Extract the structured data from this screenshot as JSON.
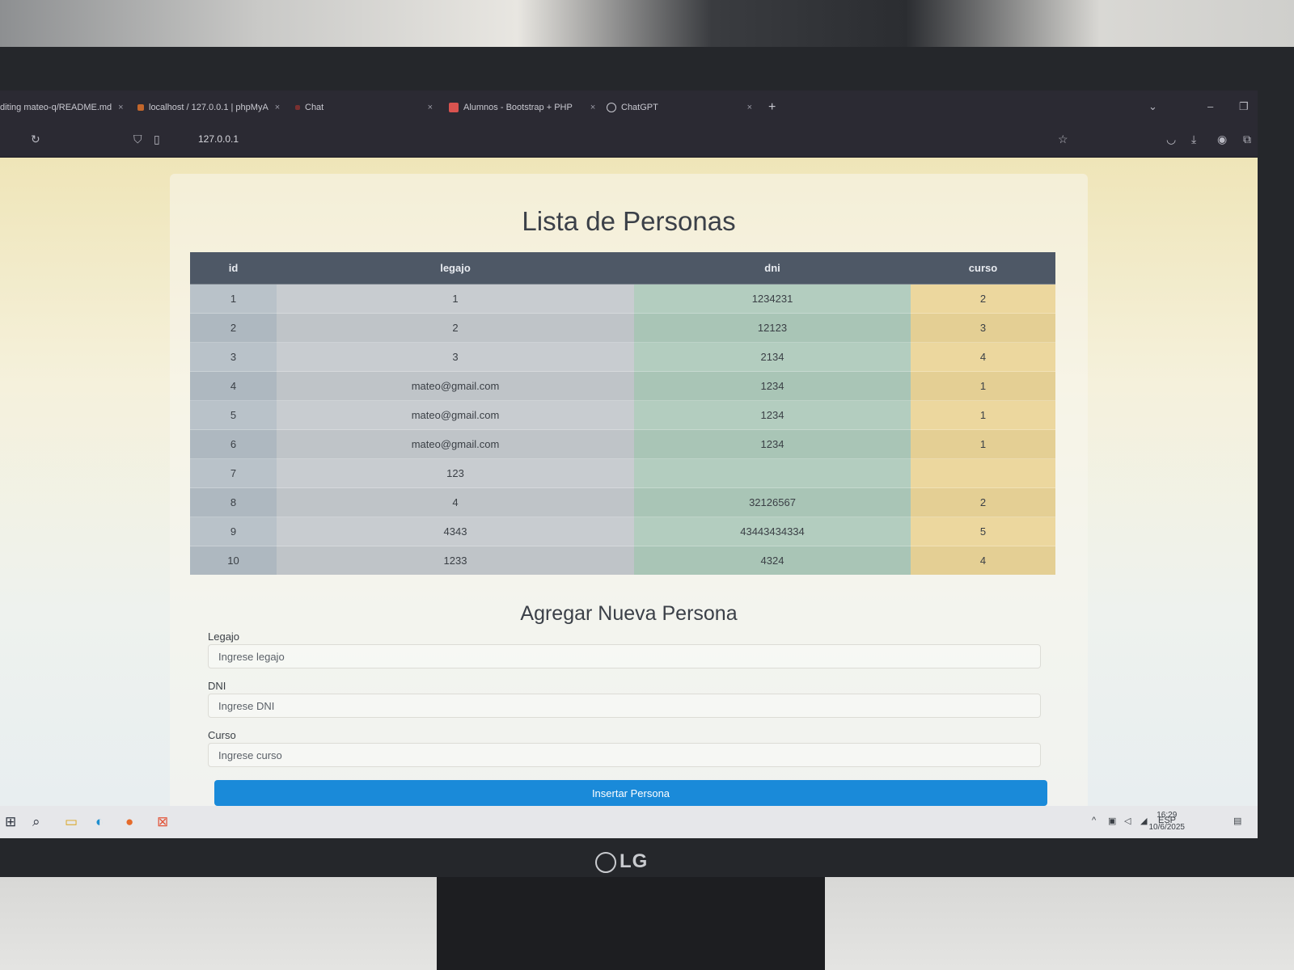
{
  "tabs": [
    {
      "label": "diting mateo-q/README.md",
      "close": "×"
    },
    {
      "label": "localhost / 127.0.0.1 | phpMyA",
      "close": "×"
    },
    {
      "label": "Chat",
      "close": "×"
    },
    {
      "label": "Alumnos - Bootstrap + PHP",
      "close": "×"
    },
    {
      "label": "ChatGPT",
      "close": "×"
    }
  ],
  "new_tab": "+",
  "window_controls": {
    "chevron": "⌄",
    "minimize": "–",
    "restore": "❐",
    "close": "✕"
  },
  "url": "127.0.0.1",
  "page": {
    "title": "Lista de Personas",
    "table": {
      "headers": [
        "id",
        "legajo",
        "dni",
        "curso"
      ],
      "rows": [
        [
          "1",
          "1",
          "1234231",
          "2"
        ],
        [
          "2",
          "2",
          "12123",
          "3"
        ],
        [
          "3",
          "3",
          "2134",
          "4"
        ],
        [
          "4",
          "mateo@gmail.com",
          "1234",
          "1"
        ],
        [
          "5",
          "mateo@gmail.com",
          "1234",
          "1"
        ],
        [
          "6",
          "mateo@gmail.com",
          "1234",
          "1"
        ],
        [
          "7",
          "123",
          "",
          ""
        ],
        [
          "8",
          "4",
          "32126567",
          "2"
        ],
        [
          "9",
          "4343",
          "43443434334",
          "5"
        ],
        [
          "10",
          "1233",
          "4324",
          "4"
        ]
      ]
    },
    "form": {
      "title": "Agregar Nueva Persona",
      "legajo_label": "Legajo",
      "legajo_placeholder": "Ingrese legajo",
      "dni_label": "DNI",
      "dni_placeholder": "Ingrese DNI",
      "curso_label": "Curso",
      "curso_placeholder": "Ingrese curso",
      "submit_label": "Insertar Persona"
    }
  },
  "taskbar": {
    "language": "ESP",
    "time": "16:29",
    "date": "10/6/2025"
  },
  "monitor_brand": "LG",
  "colors": {
    "header_bg": "#4e5866",
    "button_bg": "#1a8ad9",
    "browser_chrome": "#2b2a33"
  }
}
